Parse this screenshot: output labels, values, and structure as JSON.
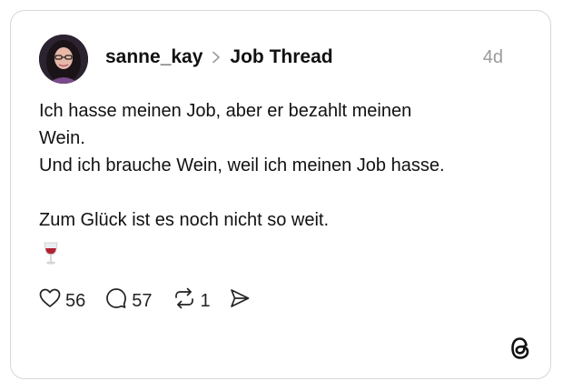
{
  "post": {
    "username": "sanne_kay",
    "thread_name": "Job Thread",
    "time": "4d",
    "lines": [
      "Ich hasse meinen Job, aber er bezahlt meinen",
      "Wein.",
      "Und ich brauche Wein, weil ich meinen Job hasse.",
      "Zum Glück ist es noch nicht so weit."
    ],
    "emoji": "🍷"
  },
  "actions": {
    "likes": "56",
    "replies": "57",
    "reposts": "1"
  },
  "icons": {
    "like": "heart-icon",
    "reply": "comment-bubble-icon",
    "repost": "repost-icon",
    "share": "send-icon",
    "chevron": "chevron-right-icon",
    "logo": "threads-logo-icon"
  },
  "colors": {
    "text": "#111111",
    "muted": "#9a9a9a",
    "border": "#d7d7d7",
    "wine": "#b3202f"
  }
}
